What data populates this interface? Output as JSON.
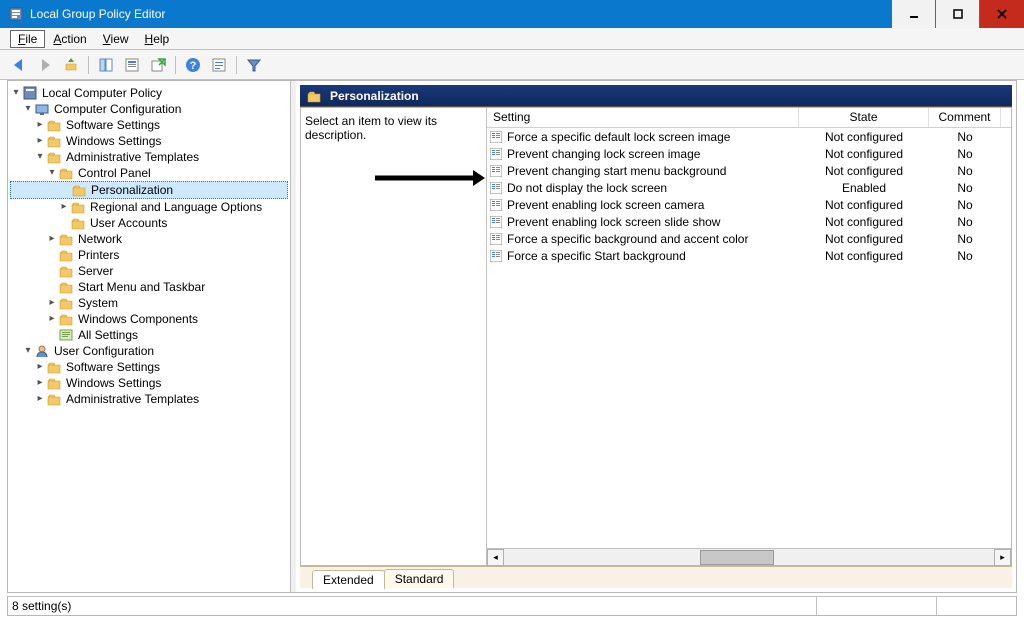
{
  "window": {
    "title": "Local Group Policy Editor"
  },
  "menu": {
    "file": "File",
    "action": "Action",
    "view": "View",
    "help": "Help"
  },
  "tree": {
    "root": "Local Computer Policy",
    "comp_config": "Computer Configuration",
    "sw_settings": "Software Settings",
    "win_settings": "Windows Settings",
    "admin_templates": "Administrative Templates",
    "control_panel": "Control Panel",
    "personalization": "Personalization",
    "regional": "Regional and Language Options",
    "user_accounts": "User Accounts",
    "network": "Network",
    "printers": "Printers",
    "server": "Server",
    "startmenu": "Start Menu and Taskbar",
    "system": "System",
    "win_components": "Windows Components",
    "all_settings": "All Settings",
    "user_config": "User Configuration",
    "u_sw_settings": "Software Settings",
    "u_win_settings": "Windows Settings",
    "u_admin_templates": "Administrative Templates"
  },
  "header": {
    "title": "Personalization"
  },
  "description_prompt": "Select an item to view its description.",
  "columns": {
    "setting": "Setting",
    "state": "State",
    "comment": "Comment"
  },
  "settings": [
    {
      "name": "Force a specific default lock screen image",
      "state": "Not configured",
      "comment": "No"
    },
    {
      "name": "Prevent changing lock screen image",
      "state": "Not configured",
      "comment": "No"
    },
    {
      "name": "Prevent changing start menu background",
      "state": "Not configured",
      "comment": "No"
    },
    {
      "name": "Do not display the lock screen",
      "state": "Enabled",
      "comment": "No"
    },
    {
      "name": "Prevent enabling lock screen camera",
      "state": "Not configured",
      "comment": "No"
    },
    {
      "name": "Prevent enabling lock screen slide show",
      "state": "Not configured",
      "comment": "No"
    },
    {
      "name": "Force a specific background and accent color",
      "state": "Not configured",
      "comment": "No"
    },
    {
      "name": "Force a specific Start background",
      "state": "Not configured",
      "comment": "No"
    }
  ],
  "tabs": {
    "extended": "Extended",
    "standard": "Standard"
  },
  "status": {
    "text": "8 setting(s)"
  }
}
